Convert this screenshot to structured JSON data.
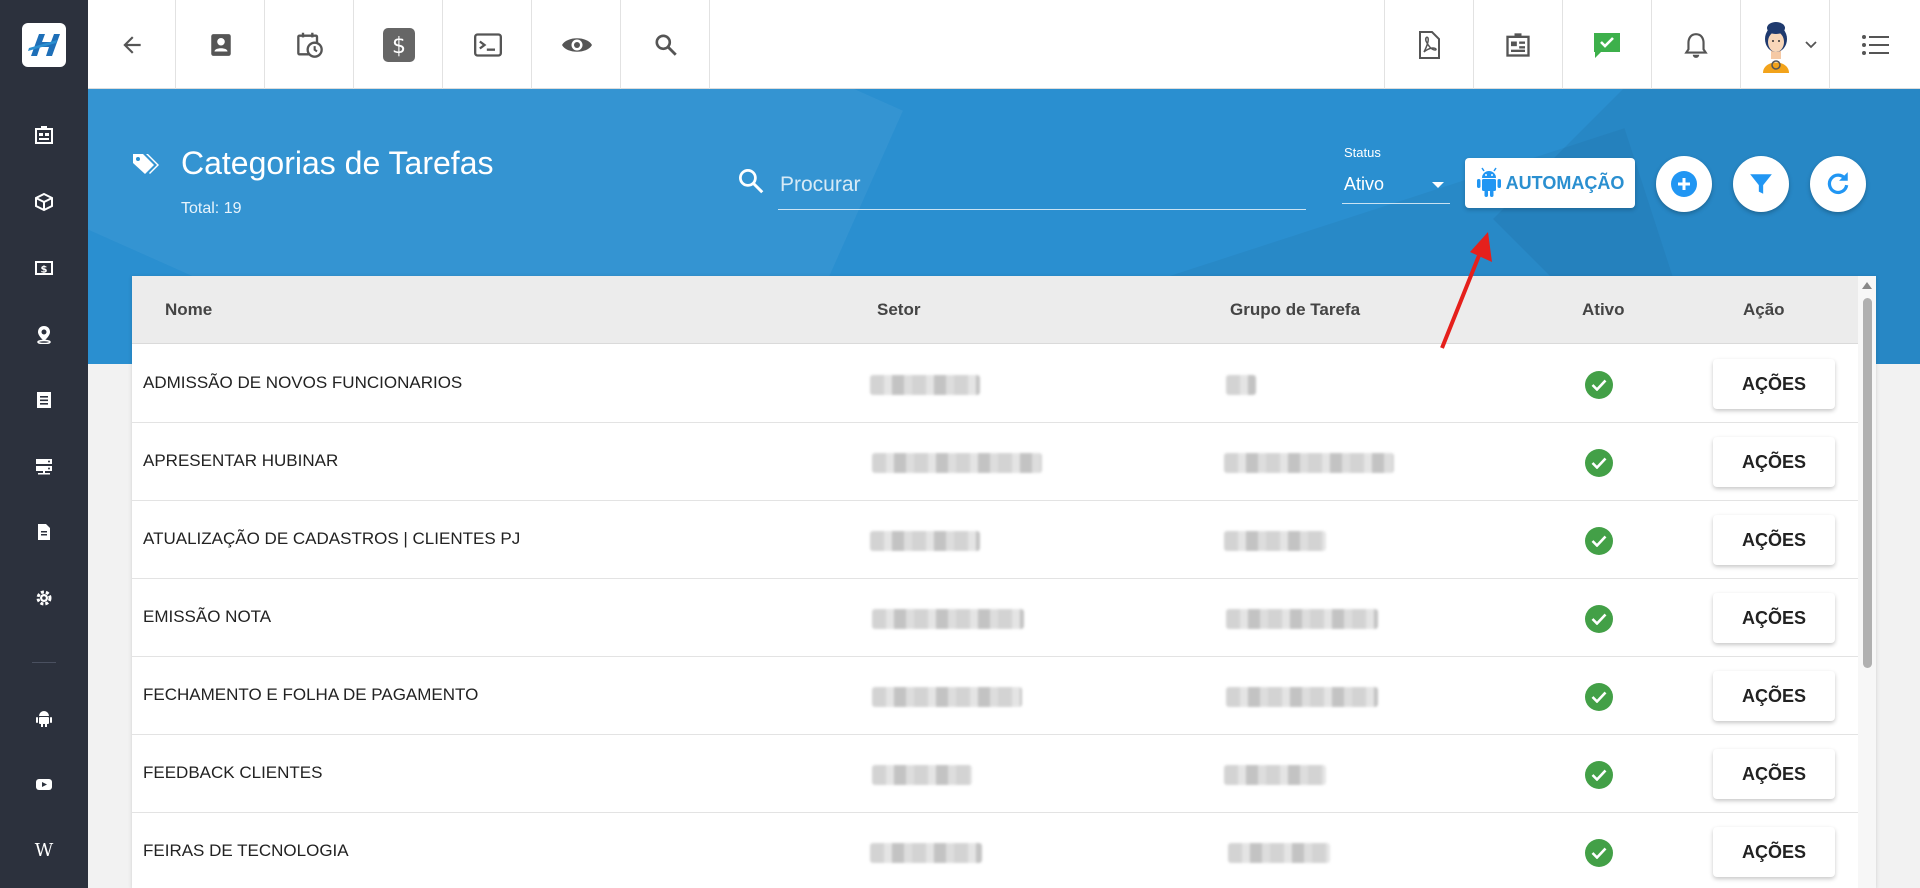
{
  "sidebar": {
    "items": [
      {
        "icon": "dashboard-icon"
      },
      {
        "icon": "cube-icon"
      },
      {
        "icon": "money-icon"
      },
      {
        "icon": "location-icon"
      },
      {
        "icon": "list-icon"
      },
      {
        "icon": "server-icon"
      },
      {
        "icon": "document-icon"
      },
      {
        "icon": "gear-icon"
      },
      {
        "icon": "android-icon"
      },
      {
        "icon": "youtube-icon"
      },
      {
        "icon": "wikipedia-icon",
        "text": "W"
      }
    ]
  },
  "topbar": {
    "left": [
      "back-arrow-icon",
      "contact-icon",
      "calendar-clock-icon",
      "dollar-icon",
      "terminal-icon",
      "eye-icon",
      "search-icon"
    ],
    "right": [
      "pdf-icon",
      "building-icon",
      "chat-check-icon",
      "bell-icon",
      "avatar",
      "menu-icon"
    ]
  },
  "header": {
    "title": "Categorias de Tarefas",
    "total": "Total: 19",
    "search_placeholder": "Procurar",
    "status_label": "Status",
    "status_value": "Ativo",
    "automation_label": "AUTOMAÇÃO"
  },
  "colors": {
    "banner": "#2a8fd0",
    "sidebar": "#2c313d",
    "accent": "#2196f3",
    "success": "#43a047",
    "annotation": "#e5201c"
  },
  "table": {
    "columns": [
      "Nome",
      "Setor",
      "Grupo de Tarefa",
      "Ativo",
      "Ação"
    ],
    "action_label": "AÇÕES",
    "rows": [
      {
        "name": "ADMISSÃO DE NOVOS FUNCIONARIOS",
        "active": true
      },
      {
        "name": "APRESENTAR HUBINAR",
        "active": true
      },
      {
        "name": "ATUALIZAÇÃO DE CADASTROS | CLIENTES PJ",
        "active": true
      },
      {
        "name": "EMISSÃO NOTA",
        "active": true
      },
      {
        "name": "FECHAMENTO E FOLHA DE PAGAMENTO",
        "active": true
      },
      {
        "name": "FEEDBACK CLIENTES",
        "active": true
      },
      {
        "name": "FEIRAS DE TECNOLOGIA",
        "active": true
      }
    ]
  }
}
